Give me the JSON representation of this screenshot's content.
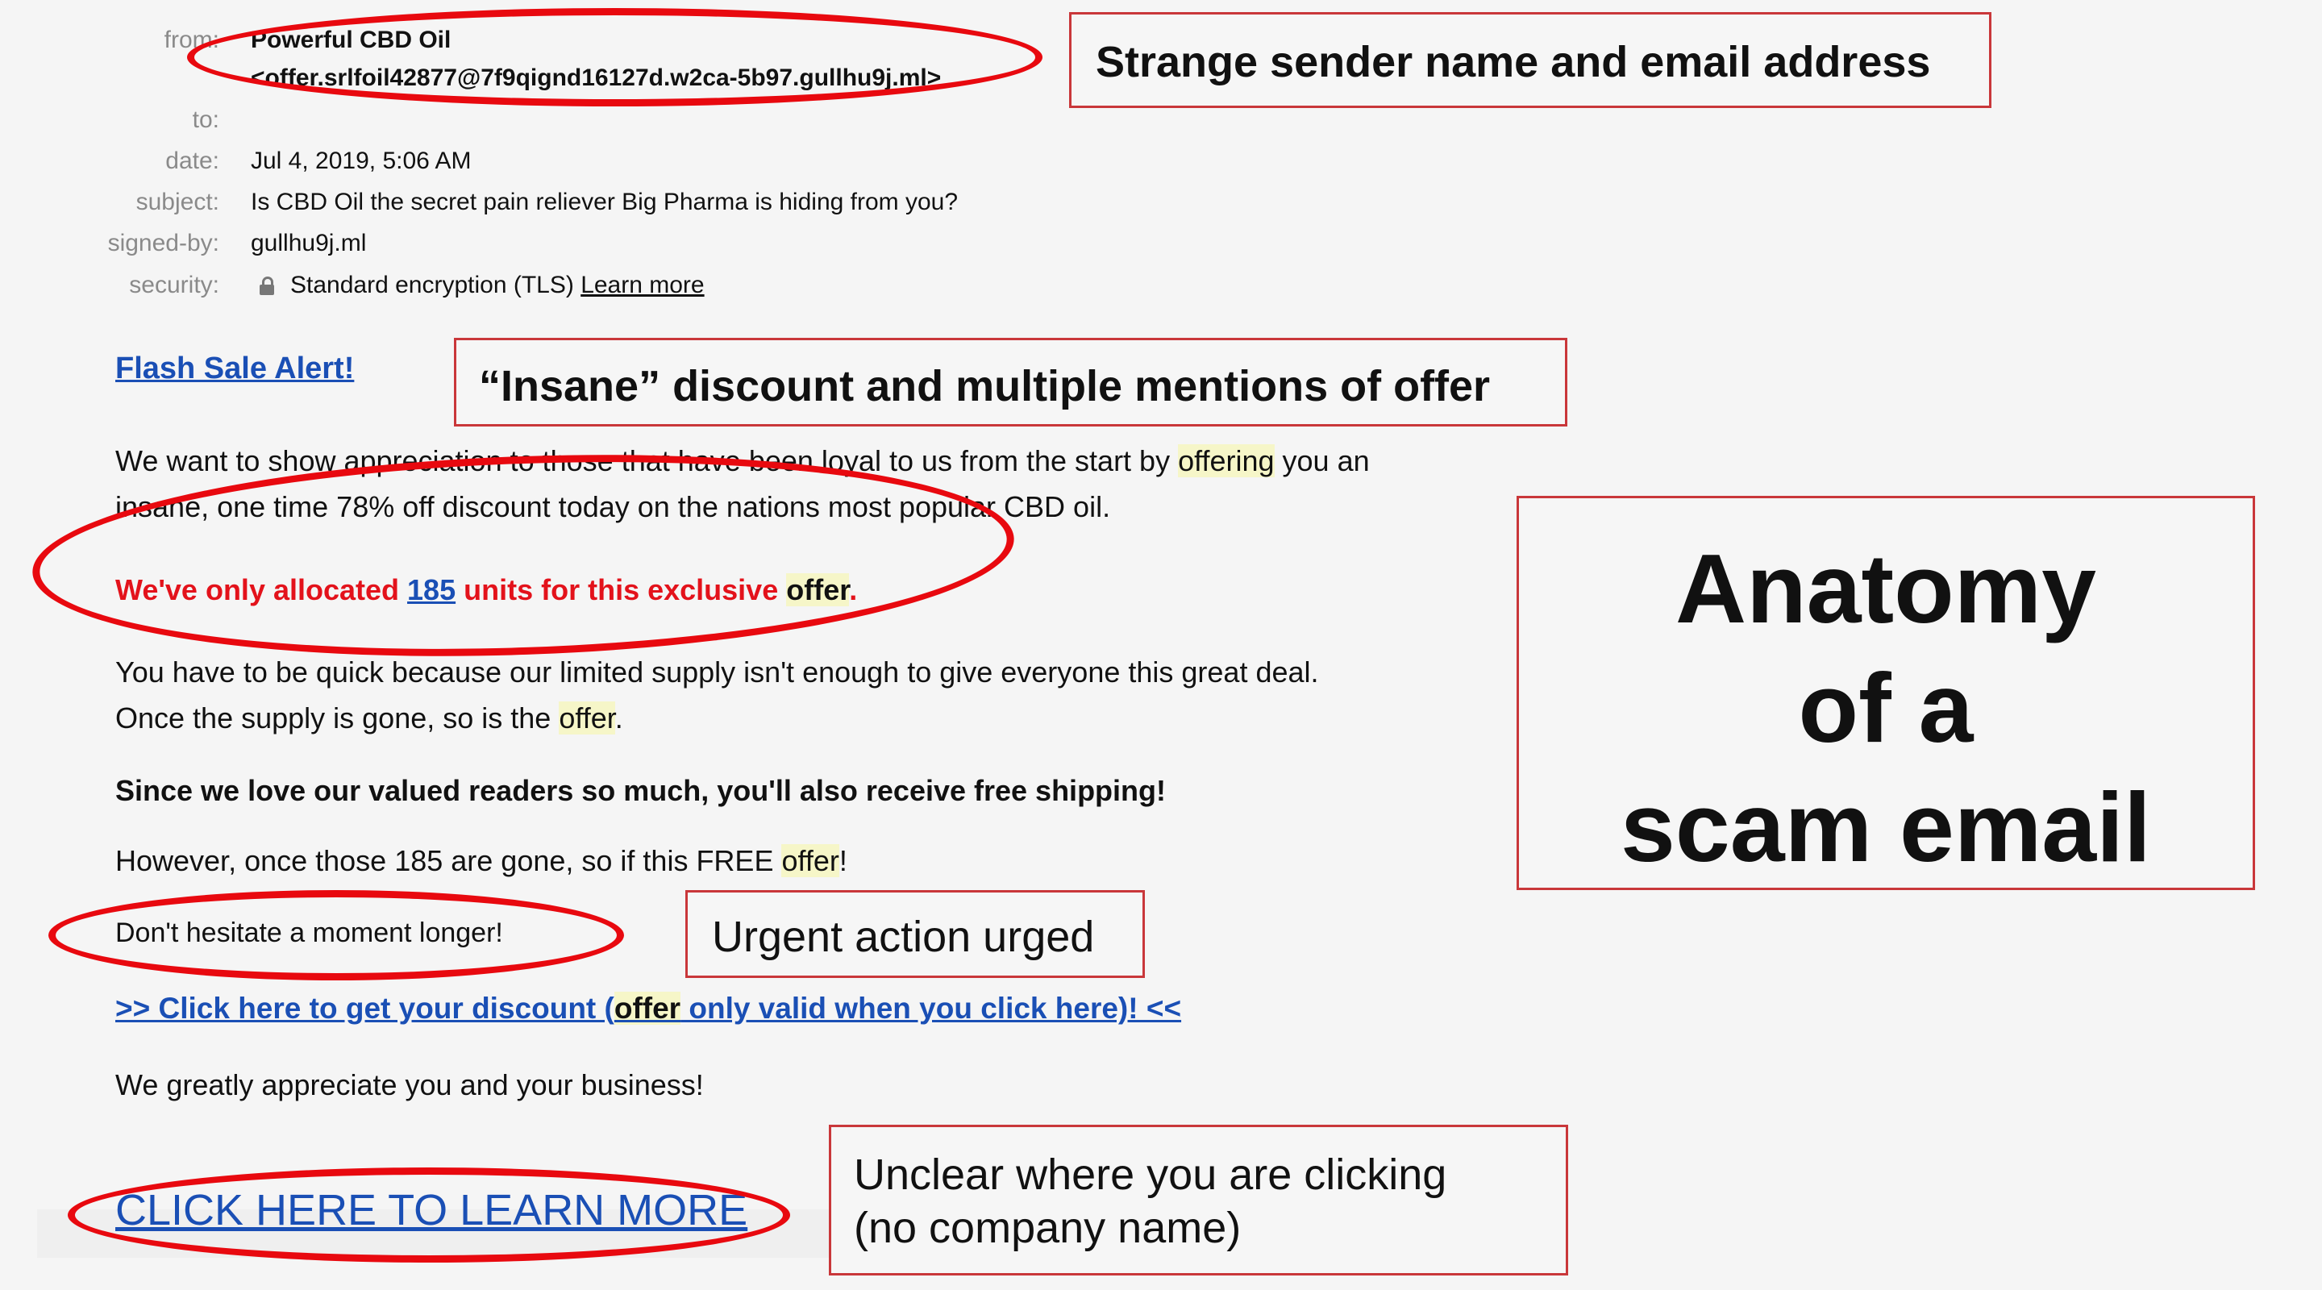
{
  "header": {
    "from_label": "from:",
    "from_name": "Powerful CBD Oil",
    "from_address": "<offer.srlfoil42877@7f9qignd16127d.w2ca-5b97.gullhu9j.ml>",
    "to_label": "to:",
    "to_value": "",
    "date_label": "date:",
    "date_value": "Jul 4, 2019, 5:06 AM",
    "subject_label": "subject:",
    "subject_value": "Is CBD Oil the secret pain reliever Big Pharma is hiding from you?",
    "signed_label": "signed-by:",
    "signed_value": "gullhu9j.ml",
    "security_label": "security:",
    "security_value": "Standard encryption (TLS)",
    "security_link": "Learn more",
    "security_icon": "lock-icon"
  },
  "body": {
    "flash_link": "Flash Sale Alert!",
    "p1_a": "We want to show appreciation to those that have been loyal to us from the start by ",
    "p1_hl": "offering",
    "p1_b": " you an",
    "p1_line2": "insane, one time 78% off discount today on the nations most popular CBD oil.",
    "p2_a": "We've only allocated ",
    "p2_num": "185",
    "p2_b": " units for this exclusive ",
    "p2_hl": "offer",
    "p2_c": ".",
    "p3_line1": "You have to be quick because our limited supply isn't enough to give everyone this great deal.",
    "p3_a": "Once the supply is gone, so is the ",
    "p3_hl": "offer",
    "p3_b": ".",
    "p4": "Since we love our valued readers so much, you'll also receive free shipping!",
    "p5_a": "However, once those 185 are gone, so if this FREE ",
    "p5_hl": "offer",
    "p5_b": "!",
    "p6": "Don't hesitate a moment longer!",
    "cta_a": ">> Click here to get your discount (",
    "cta_hl": "offer",
    "cta_b": " only valid when you click here)! <<",
    "p7": "We greatly appreciate you and your business!",
    "cta2": "CLICK HERE TO LEARN MORE"
  },
  "annotations": {
    "sender": "Strange sender name and email address",
    "insane": "“Insane” discount and multiple mentions of offer",
    "title_line1": "Anatomy",
    "title_line2": "of a",
    "title_line3": "scam email",
    "urgent": "Urgent action urged",
    "unclear_line1": "Unclear where you are clicking",
    "unclear_line2": "(no company name)"
  },
  "colors": {
    "annotation_red": "#e8090f",
    "box_border": "#c9373a",
    "link_blue": "#1a4fb5",
    "highlight": "#f6f6c8",
    "alert_red": "#e3121b"
  }
}
